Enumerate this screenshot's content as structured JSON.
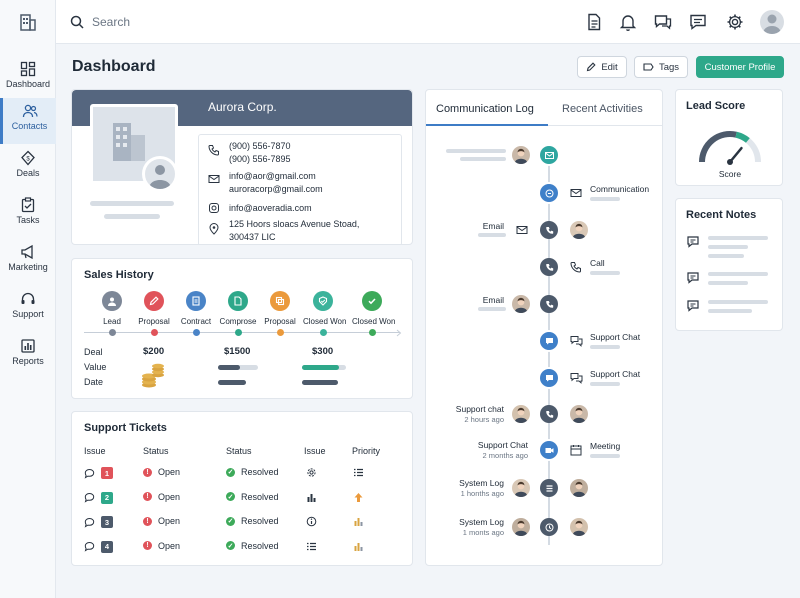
{
  "sidebar": {
    "items": [
      {
        "label": "Dashboard",
        "icon": "dashboard-icon"
      },
      {
        "label": "Contacts",
        "icon": "contacts-icon",
        "active": true
      },
      {
        "label": "Deals",
        "icon": "deals-icon"
      },
      {
        "label": "Tasks",
        "icon": "tasks-icon"
      },
      {
        "label": "Marketing",
        "icon": "megaphone-icon"
      },
      {
        "label": "Support",
        "icon": "headset-icon"
      },
      {
        "label": "Reports",
        "icon": "reports-icon"
      }
    ]
  },
  "topbar": {
    "search_placeholder": "Search",
    "icons": [
      "document-icon",
      "bell-icon",
      "chat-icon",
      "message-icon",
      "gear-icon",
      "user-avatar"
    ]
  },
  "header": {
    "title": "Dashboard",
    "edit_label": "Edit",
    "tags_label": "Tags",
    "profile_label": "Customer Profile"
  },
  "company": {
    "name": "Aurora Corp.",
    "phone1": "(900) 556-7870",
    "phone2": "(900) 556-7895",
    "email1": "info@aor@gmail.com",
    "email2": "auroracorp@gmail.com",
    "instagram": "info@aoveradia.com",
    "address1": "125 Hoors sloacs Avenue Stoad,",
    "address2": "300437 LIC"
  },
  "sales_history": {
    "title": "Sales History",
    "stages": [
      {
        "label": "Lead",
        "color": "#7d8797"
      },
      {
        "label": "Proposal",
        "color": "#e0535a"
      },
      {
        "label": "Contract",
        "color": "#4a84c7"
      },
      {
        "label": "Comprose",
        "color": "#2ea88a"
      },
      {
        "label": "Proposal",
        "color": "#eb9a3c"
      },
      {
        "label": "Closed Won",
        "color": "#3bb39b"
      },
      {
        "label": "Closed Won",
        "color": "#3daa5a"
      }
    ],
    "row_labels": [
      "Deal",
      "Value",
      "Date"
    ],
    "deals": [
      {
        "amount": "$200",
        "progress": null
      },
      {
        "amount": "$1500",
        "progress": 0.55,
        "color": "#4d5a6b"
      },
      {
        "amount": "$300",
        "progress": 0.85,
        "color": "#2ea88a"
      }
    ]
  },
  "support_tickets": {
    "title": "Support Tickets",
    "headers": [
      "Issue",
      "Status",
      "Status",
      "Issue",
      "Priority"
    ],
    "rows": [
      {
        "num": "1",
        "num_color": "#e0535a",
        "status1": "Open",
        "status2": "Resolved",
        "issue_icon": "gear-icon",
        "priority_icon": "list-icon"
      },
      {
        "num": "2",
        "num_color": "#2ea88a",
        "status1": "Open",
        "status2": "Resolved",
        "issue_icon": "bar-chart-icon",
        "priority_icon": "arrow-up-icon"
      },
      {
        "num": "3",
        "num_color": "#4d5a6b",
        "status1": "Open",
        "status2": "Resolved",
        "issue_icon": "info-icon",
        "priority_icon": "bar-chart-icon"
      },
      {
        "num": "4",
        "num_color": "#4d5a6b",
        "status1": "Open",
        "status2": "Resolved",
        "issue_icon": "list-icon",
        "priority_icon": "bar-chart-icon"
      }
    ]
  },
  "comm_log": {
    "tabs": [
      "Communication Log",
      "Recent Activities"
    ],
    "entries": [
      {
        "side": "left",
        "title": "",
        "sub": "",
        "node": "teal"
      },
      {
        "side": "right",
        "title": "Communication",
        "sub": "",
        "node": "blue"
      },
      {
        "side": "left",
        "title": "Email",
        "sub": "",
        "node": "dark"
      },
      {
        "side": "right",
        "title": "Call",
        "sub": "",
        "node": "dark"
      },
      {
        "side": "left",
        "title": "Email",
        "sub": "",
        "node": "dark"
      },
      {
        "side": "right",
        "title": "Support Chat",
        "sub": "",
        "node": "blue"
      },
      {
        "side": "right",
        "title": "Support Chat",
        "sub": "",
        "node": "blue"
      },
      {
        "side": "left",
        "title": "Support chat",
        "sub": "2 hours ago",
        "node": "dark"
      },
      {
        "side": "both",
        "title": "Support Chat",
        "sub": "2 months ago",
        "right_title": "Meeting",
        "node": "blue"
      },
      {
        "side": "left",
        "title": "System Log",
        "sub": "1 honths ago",
        "node": "dark"
      },
      {
        "side": "left",
        "title": "System Log",
        "sub": "1 monts ago",
        "node": "dark"
      }
    ]
  },
  "lead_score": {
    "title": "Lead Score",
    "label": "Score",
    "value_fraction": 0.72
  },
  "recent_notes": {
    "title": "Recent Notes"
  }
}
